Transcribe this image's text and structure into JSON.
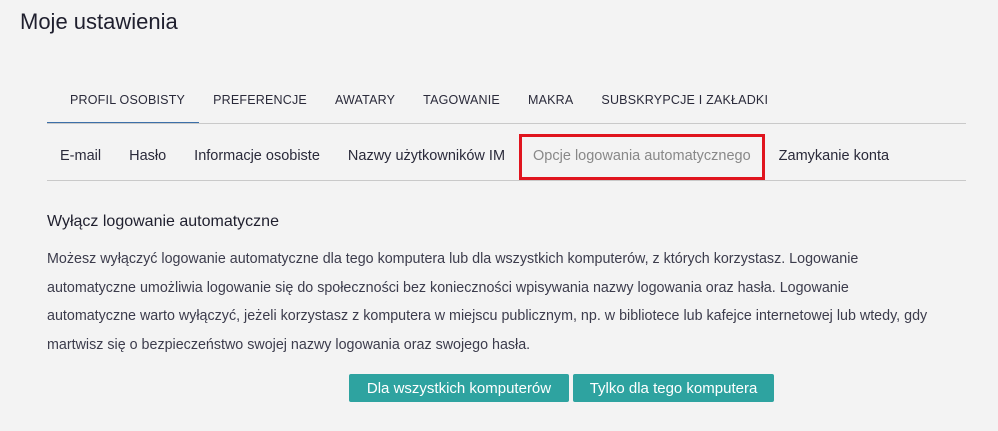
{
  "page": {
    "title": "Moje ustawienia"
  },
  "main_tabs": [
    {
      "label": "PROFIL OSOBISTY",
      "active": true
    },
    {
      "label": "PREFERENCJE"
    },
    {
      "label": "AWATARY"
    },
    {
      "label": "TAGOWANIE"
    },
    {
      "label": "MAKRA"
    },
    {
      "label": "SUBSKRYPCJE I ZAKŁADKI"
    }
  ],
  "sub_tabs": [
    {
      "label": "E-mail"
    },
    {
      "label": "Hasło"
    },
    {
      "label": "Informacje osobiste"
    },
    {
      "label": "Nazwy użytkowników IM"
    },
    {
      "label": "Opcje logowania automatycznego",
      "active": true
    },
    {
      "label": "Zamykanie konta"
    }
  ],
  "section": {
    "heading": "Wyłącz logowanie automatyczne",
    "body": "Możesz wyłączyć logowanie automatyczne dla tego komputera lub dla wszystkich komputerów, z których korzystasz. Logowanie automatyczne umożliwia logowanie się do społeczności bez konieczności wpisywania nazwy logowania oraz hasła. Logowanie automatyczne warto wyłączyć, jeżeli korzystasz z komputera w miejscu publicznym, np. w bibliotece lub kafejce internetowej lub wtedy, gdy martwisz się o bezpieczeństwo swojej nazwy logowania oraz swojego hasła."
  },
  "buttons": {
    "all_computers": "Dla wszystkich komputerów",
    "this_computer": "Tylko dla tego komputera"
  },
  "colors": {
    "button_bg": "#2ea3a0",
    "highlight_border": "#e0141e",
    "active_tab_underline": "#3b6fa8"
  }
}
